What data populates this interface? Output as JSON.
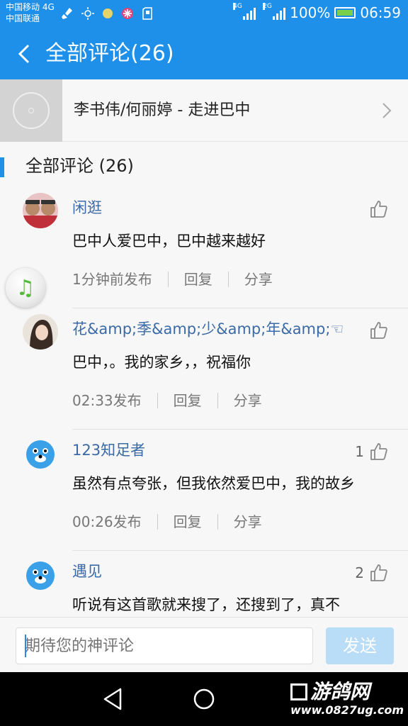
{
  "status_bar": {
    "carrier_1": "中国移动 4G",
    "carrier_2": "中国联通",
    "net_1": "4G",
    "net_2": "2G",
    "battery": "100%",
    "time": "06:59"
  },
  "header": {
    "title": "全部评论(26)"
  },
  "song": {
    "title": "李书伟/何丽婷 - 走进巴中"
  },
  "section": {
    "title": "全部评论 (26)"
  },
  "comments": [
    {
      "name": "闲逛",
      "text": "巴中人爱巴中，巴中越来越好",
      "time": "1分钟前发布",
      "reply": "回复",
      "share": "分享",
      "likes": ""
    },
    {
      "name": "花&amp;季&amp;少&amp;年&amp;☜",
      "text": "巴中，。我的家乡，，祝福你",
      "time": "02:33发布",
      "reply": "回复",
      "share": "分享",
      "likes": ""
    },
    {
      "name": "123知足者",
      "text": "虽然有点夸张，但我依然爱巴中，我的故乡",
      "time": "00:26发布",
      "reply": "回复",
      "share": "分享",
      "likes": "1"
    },
    {
      "name": "遇见",
      "text": "听说有这首歌就来搜了，还搜到了，真不",
      "time": "",
      "reply": "",
      "share": "",
      "likes": "2"
    }
  ],
  "input": {
    "placeholder": "期待您的神评论",
    "send_label": "发送"
  },
  "watermark": {
    "logo": "游鸽网",
    "url": "www.0827ug.com"
  },
  "colors": {
    "accent": "#1e90ea",
    "name_link": "#3b6aa6",
    "send_disabled": "#b9dcf7"
  }
}
